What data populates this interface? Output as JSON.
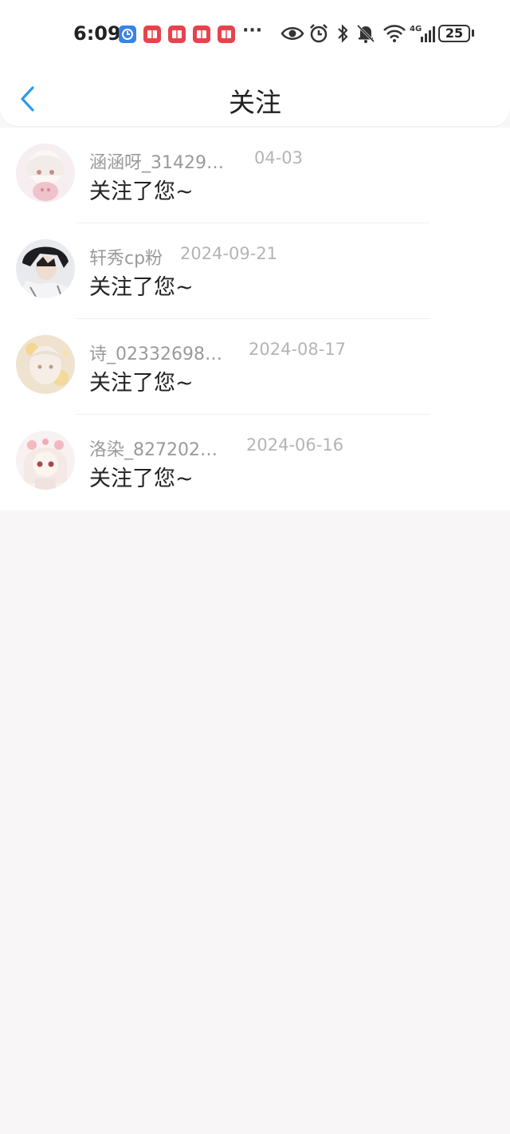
{
  "status_bar": {
    "time": "6:09",
    "more": "···",
    "battery": "25"
  },
  "nav": {
    "title": "关注"
  },
  "items": [
    {
      "name": "涵涵呀_31429…",
      "date": "04-03",
      "message": "关注了您~"
    },
    {
      "name": "轩秀cp粉",
      "date": "2024-09-21",
      "message": "关注了您~"
    },
    {
      "name": "诗_02332698…",
      "date": "2024-08-17",
      "message": "关注了您~"
    },
    {
      "name": "洛染_827202…",
      "date": "2024-06-16",
      "message": "关注了您~"
    }
  ],
  "colors": {
    "accent": "#2f9be8",
    "background": "#f8f6f7",
    "name_text": "#9a9a9a",
    "date_text": "#b4b4b4"
  }
}
